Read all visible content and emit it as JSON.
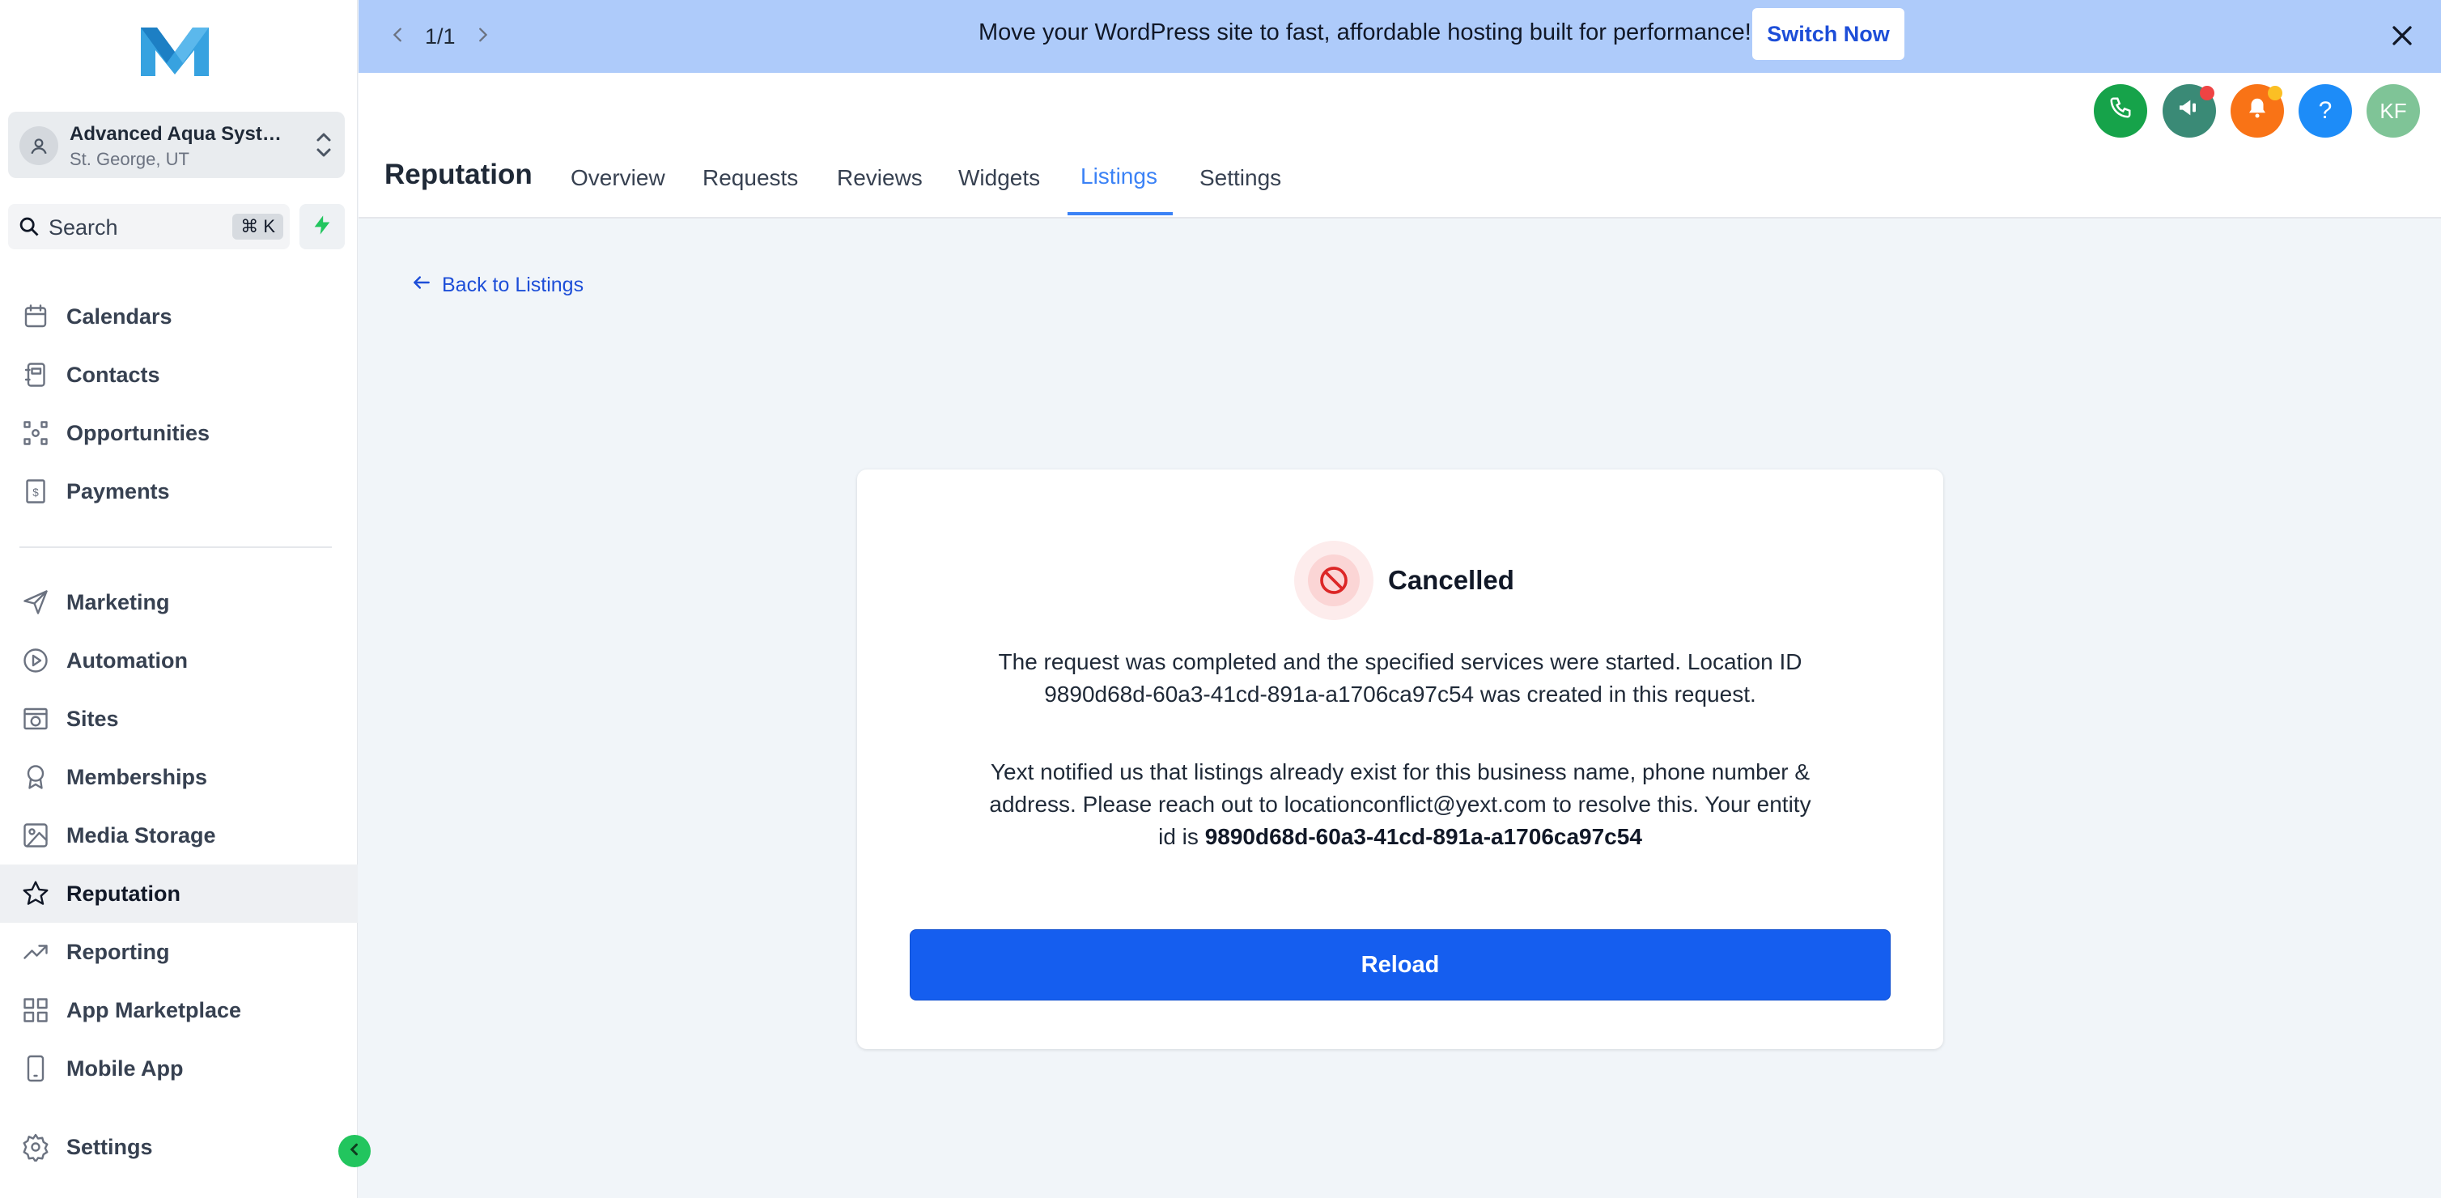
{
  "brand": {
    "logo_icon": "logo-m-icon",
    "accent": "#3b82f6",
    "primary_button": "#155eef"
  },
  "account": {
    "name": "Advanced Aqua Syst…",
    "location": "St. George, UT"
  },
  "search": {
    "label": "Search",
    "shortcut": "⌘ K"
  },
  "sidebar": {
    "items": [
      {
        "label": "Calendars",
        "icon": "calendar-icon"
      },
      {
        "label": "Contacts",
        "icon": "contacts-icon"
      },
      {
        "label": "Opportunities",
        "icon": "opportunities-icon"
      },
      {
        "label": "Payments",
        "icon": "payments-icon"
      },
      {
        "label": "Marketing",
        "icon": "send-icon"
      },
      {
        "label": "Automation",
        "icon": "automation-icon"
      },
      {
        "label": "Sites",
        "icon": "sites-icon"
      },
      {
        "label": "Memberships",
        "icon": "badge-icon"
      },
      {
        "label": "Media Storage",
        "icon": "image-icon"
      },
      {
        "label": "Reputation",
        "icon": "star-icon",
        "active": true
      },
      {
        "label": "Reporting",
        "icon": "trending-icon"
      },
      {
        "label": "App Marketplace",
        "icon": "grid-icon"
      },
      {
        "label": "Mobile App",
        "icon": "mobile-icon"
      },
      {
        "label": "Settings",
        "icon": "gear-icon"
      }
    ]
  },
  "banner": {
    "pager": "1/1",
    "message": "Move your WordPress site to fast, affordable hosting built for performance!",
    "cta": "Switch Now"
  },
  "header": {
    "title": "Reputation",
    "tabs": [
      {
        "label": "Overview"
      },
      {
        "label": "Requests"
      },
      {
        "label": "Reviews"
      },
      {
        "label": "Widgets"
      },
      {
        "label": "Listings",
        "active": true
      },
      {
        "label": "Settings"
      }
    ],
    "avatar_initials": "KF",
    "help_label": "?"
  },
  "content": {
    "back_link": "Back to Listings",
    "status": "Cancelled",
    "paragraph1": "The request was completed and the specified services were started. Location ID 9890d68d-60a3-41cd-891a-a1706ca97c54 was created in this request.",
    "paragraph2_prefix": "Yext notified us that listings already exist for this business name, phone number & address. Please reach out to locationconflict@yext.com to resolve this. Your entity id is ",
    "entity_id": "9890d68d-60a3-41cd-891a-a1706ca97c54",
    "reload_label": "Reload"
  }
}
